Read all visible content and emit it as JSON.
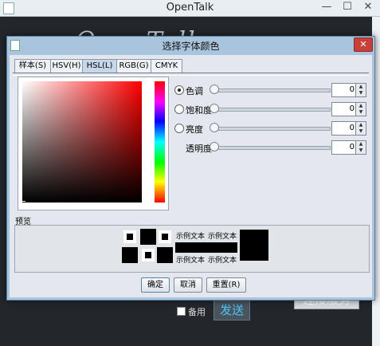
{
  "app": {
    "title": "OpenTalk",
    "logo_text": "OpenTalk",
    "controls": {
      "minimize": "—",
      "maximize": "☐",
      "close": "✕"
    },
    "standby_label": "备用",
    "send_label": "发送",
    "connect_label": "连接服务"
  },
  "dialog": {
    "title": "选择字体颜色",
    "close": "✕",
    "tabs": [
      {
        "label": "样本(S)",
        "active": false
      },
      {
        "label": "HSV(H)",
        "active": false
      },
      {
        "label": "HSL(L)",
        "active": true
      },
      {
        "label": "RGB(G)",
        "active": false
      },
      {
        "label": "CMYK",
        "active": false
      }
    ],
    "hsl": {
      "rows": [
        {
          "label": "色调",
          "value": "0",
          "selected": true,
          "has_radio": true
        },
        {
          "label": "饱和度",
          "value": "0",
          "selected": false,
          "has_radio": true
        },
        {
          "label": "亮度",
          "value": "0",
          "selected": false,
          "has_radio": true
        },
        {
          "label": "透明度",
          "value": "0",
          "selected": false,
          "has_radio": false
        }
      ]
    },
    "preview": {
      "label": "预览",
      "sample_text": "示例文本",
      "swatch_color": "#000000"
    },
    "buttons": {
      "ok": "确定",
      "cancel": "取消",
      "reset": "重置(R)"
    }
  },
  "colors": {
    "dialog_frame": "#a9c4dd",
    "close_red": "#c9403a",
    "send_blue": "#4fc3f7"
  }
}
